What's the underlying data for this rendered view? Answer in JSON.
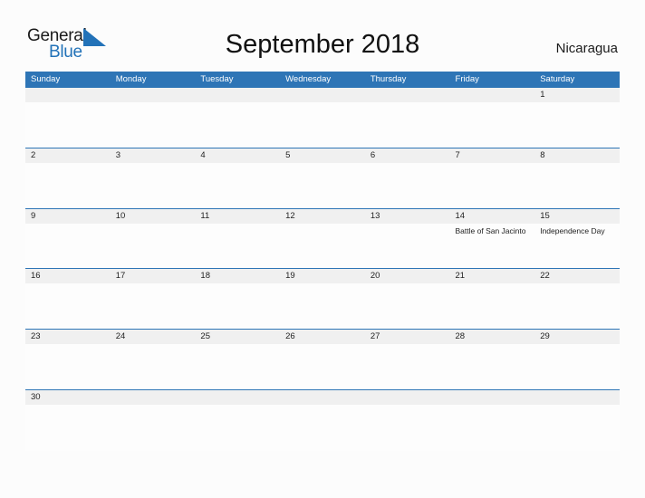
{
  "brand": {
    "name_part1": "General",
    "name_part2": "Blue",
    "flag_icon": "blue-triangle-flag-icon",
    "color_dark": "#1b1b1b",
    "color_blue": "#2272b8"
  },
  "header": {
    "title": "September 2018",
    "month": "September",
    "year": "2018",
    "country": "Nicaragua"
  },
  "theme": {
    "header_blue": "#2e75b6",
    "date_band_gray": "#f0f0f0",
    "page_background": "#fcfcfc",
    "text_color": "#222222"
  },
  "calendar": {
    "weekdays": [
      "Sunday",
      "Monday",
      "Tuesday",
      "Wednesday",
      "Thursday",
      "Friday",
      "Saturday"
    ],
    "weeks": [
      {
        "days": [
          {
            "date": "",
            "event": ""
          },
          {
            "date": "",
            "event": ""
          },
          {
            "date": "",
            "event": ""
          },
          {
            "date": "",
            "event": ""
          },
          {
            "date": "",
            "event": ""
          },
          {
            "date": "",
            "event": ""
          },
          {
            "date": "1",
            "event": ""
          }
        ]
      },
      {
        "days": [
          {
            "date": "2",
            "event": ""
          },
          {
            "date": "3",
            "event": ""
          },
          {
            "date": "4",
            "event": ""
          },
          {
            "date": "5",
            "event": ""
          },
          {
            "date": "6",
            "event": ""
          },
          {
            "date": "7",
            "event": ""
          },
          {
            "date": "8",
            "event": ""
          }
        ]
      },
      {
        "days": [
          {
            "date": "9",
            "event": ""
          },
          {
            "date": "10",
            "event": ""
          },
          {
            "date": "11",
            "event": ""
          },
          {
            "date": "12",
            "event": ""
          },
          {
            "date": "13",
            "event": ""
          },
          {
            "date": "14",
            "event": "Battle of San Jacinto"
          },
          {
            "date": "15",
            "event": "Independence Day"
          }
        ]
      },
      {
        "days": [
          {
            "date": "16",
            "event": ""
          },
          {
            "date": "17",
            "event": ""
          },
          {
            "date": "18",
            "event": ""
          },
          {
            "date": "19",
            "event": ""
          },
          {
            "date": "20",
            "event": ""
          },
          {
            "date": "21",
            "event": ""
          },
          {
            "date": "22",
            "event": ""
          }
        ]
      },
      {
        "days": [
          {
            "date": "23",
            "event": ""
          },
          {
            "date": "24",
            "event": ""
          },
          {
            "date": "25",
            "event": ""
          },
          {
            "date": "26",
            "event": ""
          },
          {
            "date": "27",
            "event": ""
          },
          {
            "date": "28",
            "event": ""
          },
          {
            "date": "29",
            "event": ""
          }
        ]
      },
      {
        "days": [
          {
            "date": "30",
            "event": ""
          },
          {
            "date": "",
            "event": ""
          },
          {
            "date": "",
            "event": ""
          },
          {
            "date": "",
            "event": ""
          },
          {
            "date": "",
            "event": ""
          },
          {
            "date": "",
            "event": ""
          },
          {
            "date": "",
            "event": ""
          }
        ]
      }
    ]
  }
}
